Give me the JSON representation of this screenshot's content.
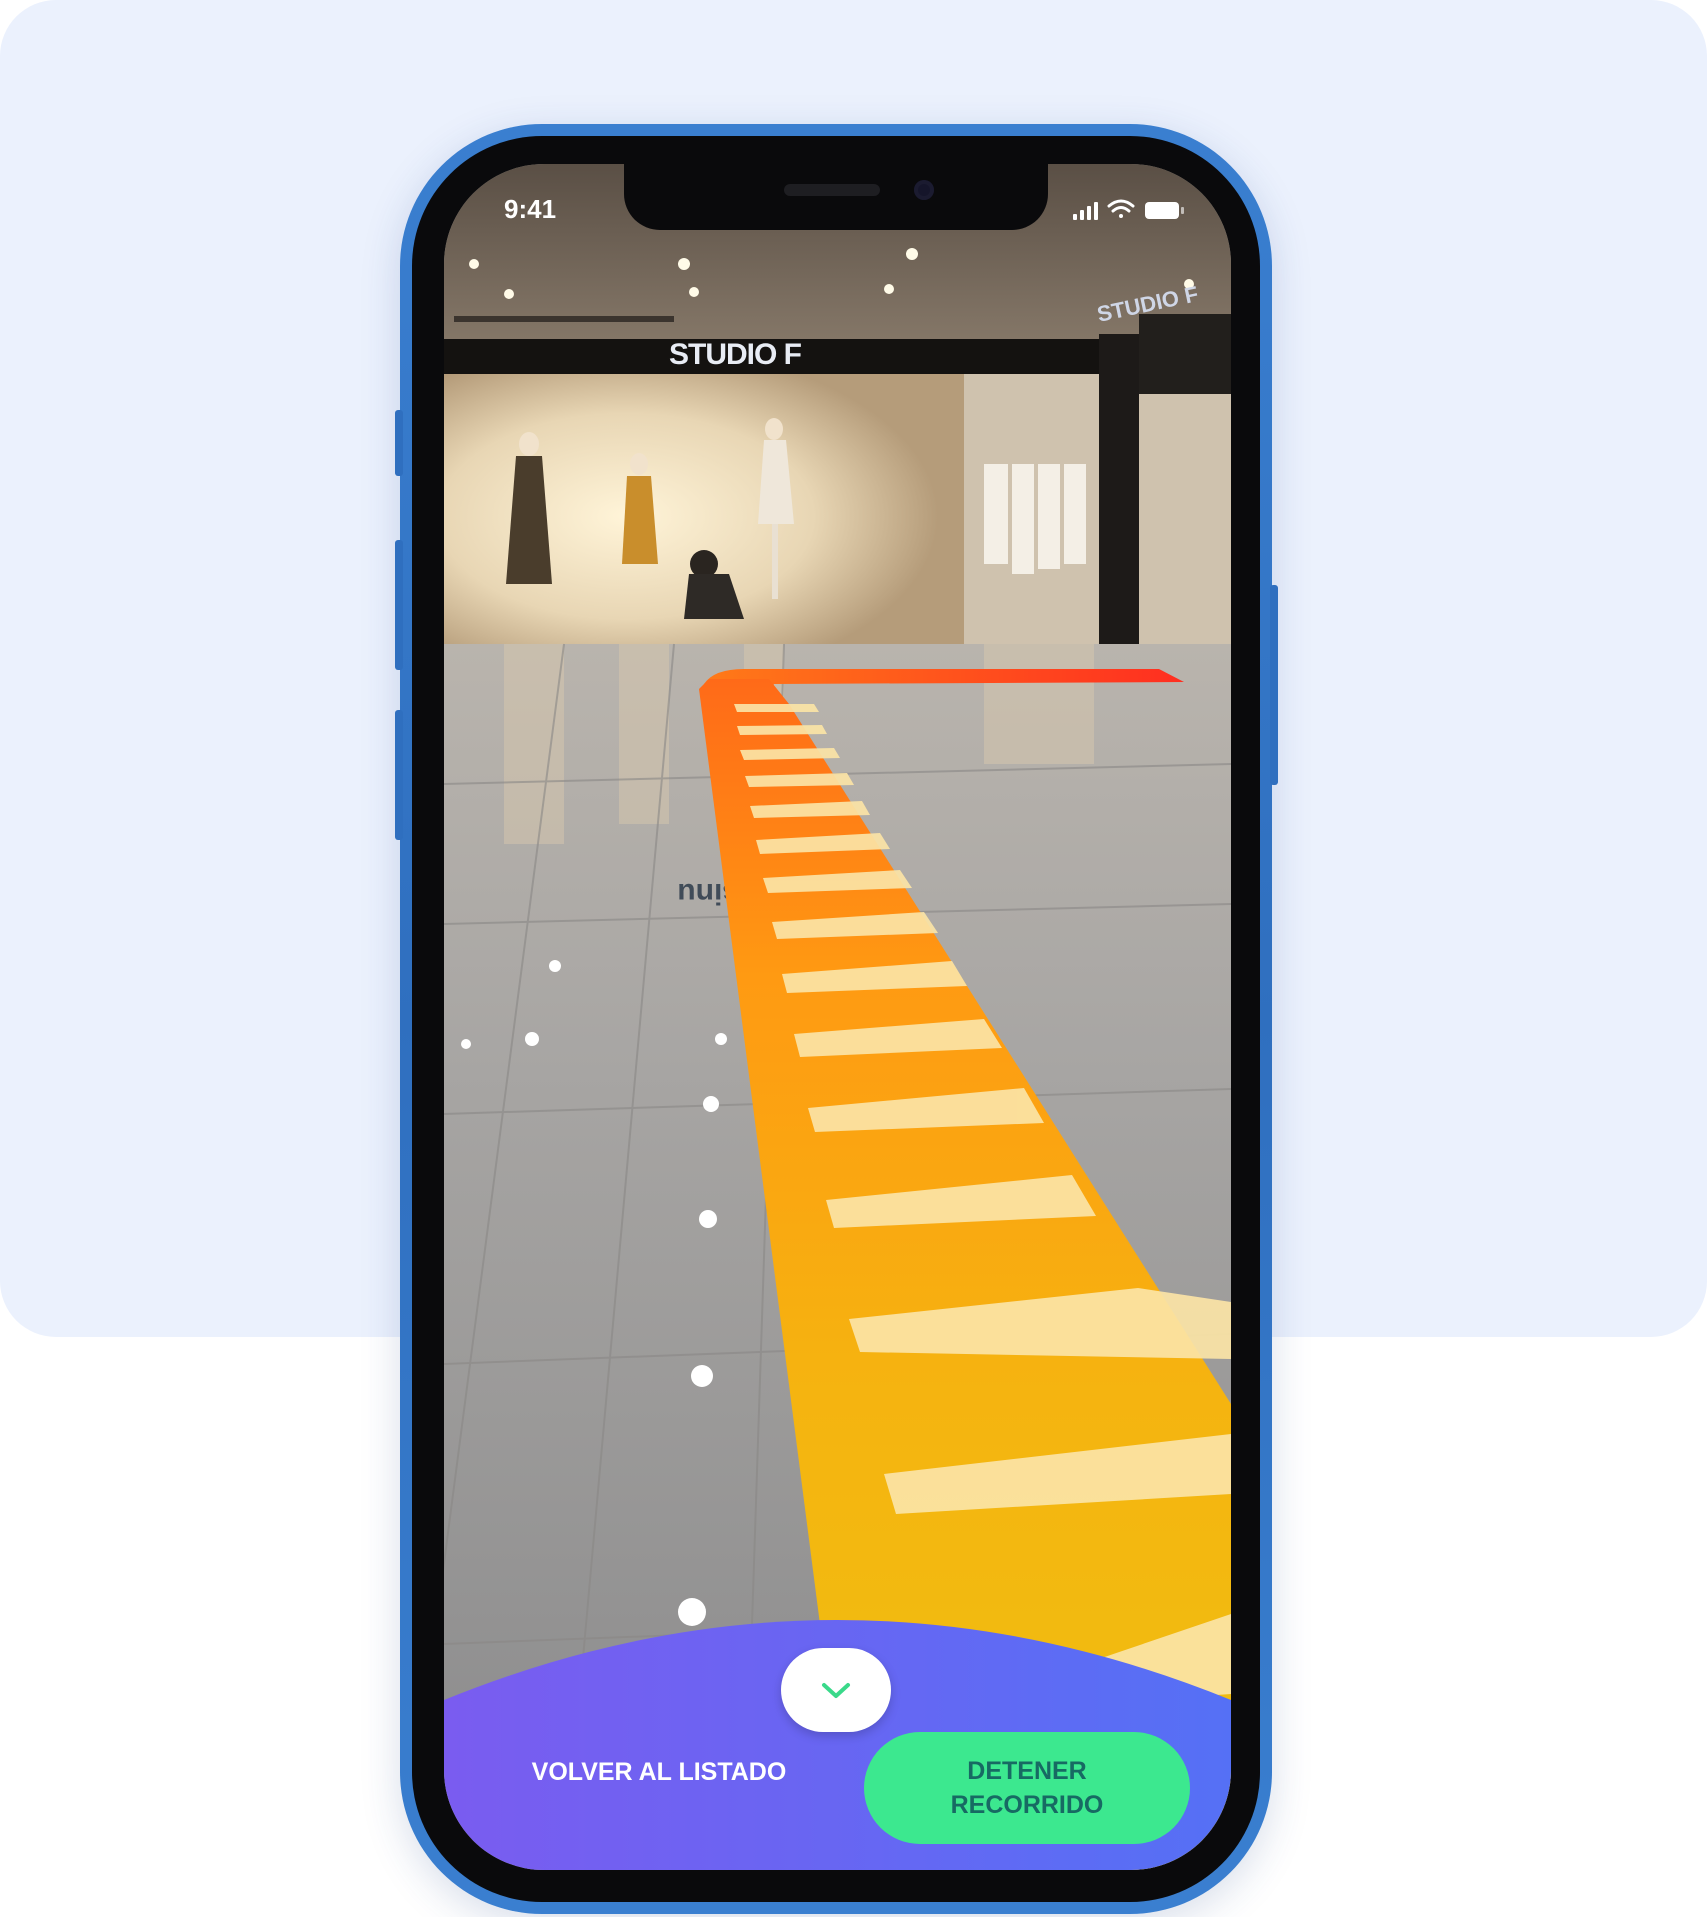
{
  "status_bar": {
    "time": "9:41",
    "signal_icon": "cellular-signal-icon",
    "wifi_icon": "wifi-icon",
    "battery_icon": "battery-icon"
  },
  "ar_view": {
    "store_sign": "STUDIO F",
    "side_sign": "STUDIO F",
    "floor_reflection_text": "sinu"
  },
  "bottom_panel": {
    "toggle_icon": "chevron-down-icon",
    "back_label": "VOLVER AL LISTADO",
    "stop_label_line1": "DETENER",
    "stop_label_line2": "RECORRIDO"
  },
  "colors": {
    "background_panel": "#ebf1fd",
    "phone_frame": "#3a7fd0",
    "panel_gradient_start": "#7a5cf0",
    "panel_gradient_end": "#5570f5",
    "stop_button": "#3ce88f",
    "stop_text": "#176a63",
    "path_start": "#ff3b1f",
    "path_mid": "#ff8a12",
    "path_end": "#f2bf10",
    "chevron_accent": "#3ad98a"
  }
}
